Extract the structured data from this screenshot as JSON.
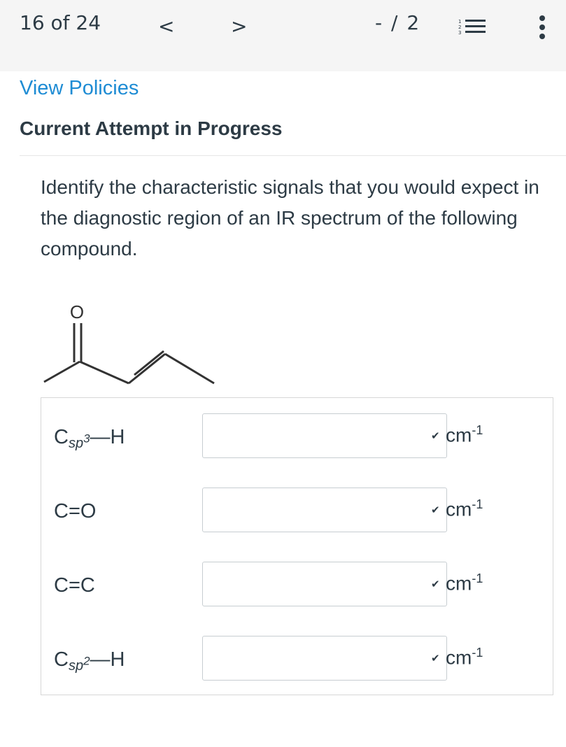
{
  "topbar": {
    "counter": "16 of 24",
    "prev": "<",
    "next": ">",
    "score": "- / 2",
    "list_numbers": [
      "1",
      "2",
      "3"
    ]
  },
  "policies_link": "View Policies",
  "attempt_heading": "Current Attempt in Progress",
  "question": "Identify the characteristic signals that you would expect in the diagnostic region of an IR spectrum of the following compound.",
  "molecule": {
    "oxygen_label": "O"
  },
  "rows": [
    {
      "bond": "C",
      "sub": "sp",
      "sup": "3",
      "suffix": "—H",
      "unit": "cm",
      "unit_exp": "-1"
    },
    {
      "bond": "C=O",
      "unit": "cm",
      "unit_exp": "-1"
    },
    {
      "bond": "C=C",
      "unit": "cm",
      "unit_exp": "-1"
    },
    {
      "bond": "C",
      "sub": "sp",
      "sup": "2",
      "suffix": "—H",
      "unit": "cm",
      "unit_exp": "-1"
    }
  ],
  "icons": {
    "dropdown": "chevron-down-icon",
    "more": "kebab-icon",
    "list": "numbered-list-icon"
  },
  "colors": {
    "link": "#1e8cd4",
    "text": "#2d3b45",
    "topbar": "#f5f5f5"
  }
}
